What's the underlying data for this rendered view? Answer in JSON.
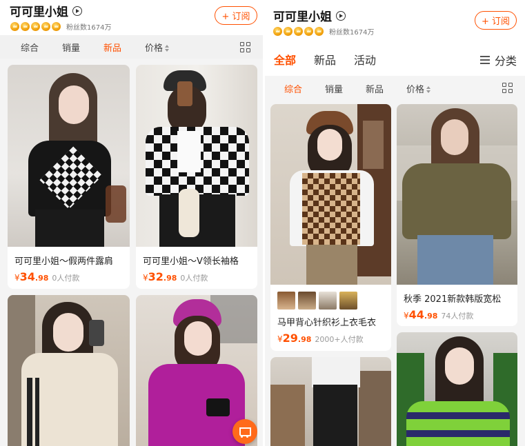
{
  "left_panel": {
    "shop_name": "可可里小姐",
    "fans": "粉丝数1674万",
    "subscribe": "+ 订阅",
    "sort_tabs": [
      "综合",
      "销量",
      "新品",
      "价格"
    ],
    "active_sort": "新品",
    "products": [
      {
        "title": "可可里小姐～假两件露肩",
        "yen": "¥",
        "price_int": "34",
        "price_dec": ".98",
        "sold": "0人付款"
      },
      {
        "title": "可可里小姐～V领长袖格",
        "yen": "¥",
        "price_int": "32",
        "price_dec": ".98",
        "sold": "0人付款"
      },
      {
        "title": "",
        "yen": "",
        "price_int": "",
        "price_dec": "",
        "sold": ""
      },
      {
        "title": "",
        "yen": "",
        "price_int": "",
        "price_dec": "",
        "sold": ""
      }
    ]
  },
  "right_panel": {
    "shop_name": "可可里小姐",
    "fans": "粉丝数1674万",
    "subscribe": "+ 订阅",
    "main_tabs": [
      "全部",
      "新品",
      "活动"
    ],
    "active_main_tab": "全部",
    "category": "分类",
    "sort_tabs": [
      "综合",
      "销量",
      "新品",
      "价格"
    ],
    "active_sort": "综合",
    "products": [
      {
        "title": "马甲背心针织衫上衣毛衣",
        "yen": "¥",
        "price_int": "29",
        "price_dec": ".98",
        "sold": "2000+人付款"
      },
      {
        "title": "秋季 2021新款韩版宽松",
        "yen": "¥",
        "price_int": "44",
        "price_dec": ".98",
        "sold": "74人付款"
      }
    ]
  },
  "colors": {
    "accent": "#ff5000",
    "background": "#f4f4f4",
    "card": "#ffffff"
  },
  "icons": [
    "info-icon",
    "crown-icon",
    "sort-arrows-icon",
    "grid-view-icon",
    "list-icon",
    "cart-icon"
  ]
}
